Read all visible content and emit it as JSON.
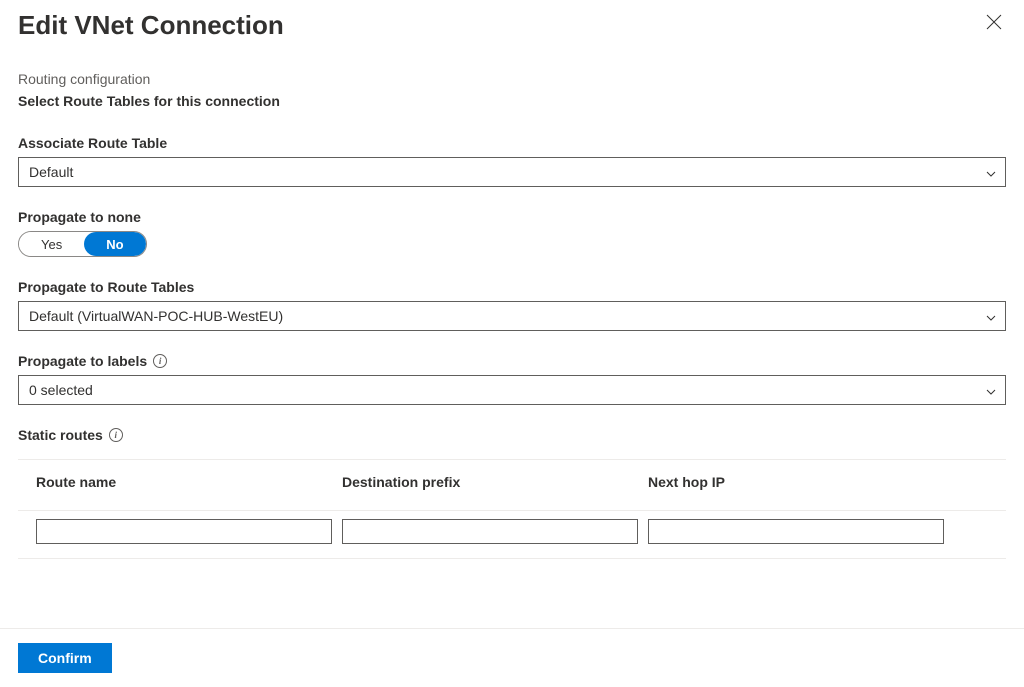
{
  "header": {
    "title": "Edit VNet Connection"
  },
  "routing": {
    "subtitle": "Routing configuration",
    "heading": "Select Route Tables for this connection"
  },
  "associate": {
    "label": "Associate Route Table",
    "value": "Default"
  },
  "propagateNone": {
    "label": "Propagate to none",
    "yes": "Yes",
    "no": "No"
  },
  "propagateTables": {
    "label": "Propagate to Route Tables",
    "value": "Default (VirtualWAN-POC-HUB-WestEU)"
  },
  "propagateLabels": {
    "label": "Propagate to labels",
    "value": "0 selected"
  },
  "staticRoutes": {
    "label": "Static routes",
    "columns": {
      "routeName": "Route name",
      "destPrefix": "Destination prefix",
      "nextHop": "Next hop IP"
    },
    "row": {
      "routeName": "",
      "destPrefix": "",
      "nextHop": ""
    }
  },
  "footer": {
    "confirm": "Confirm"
  }
}
